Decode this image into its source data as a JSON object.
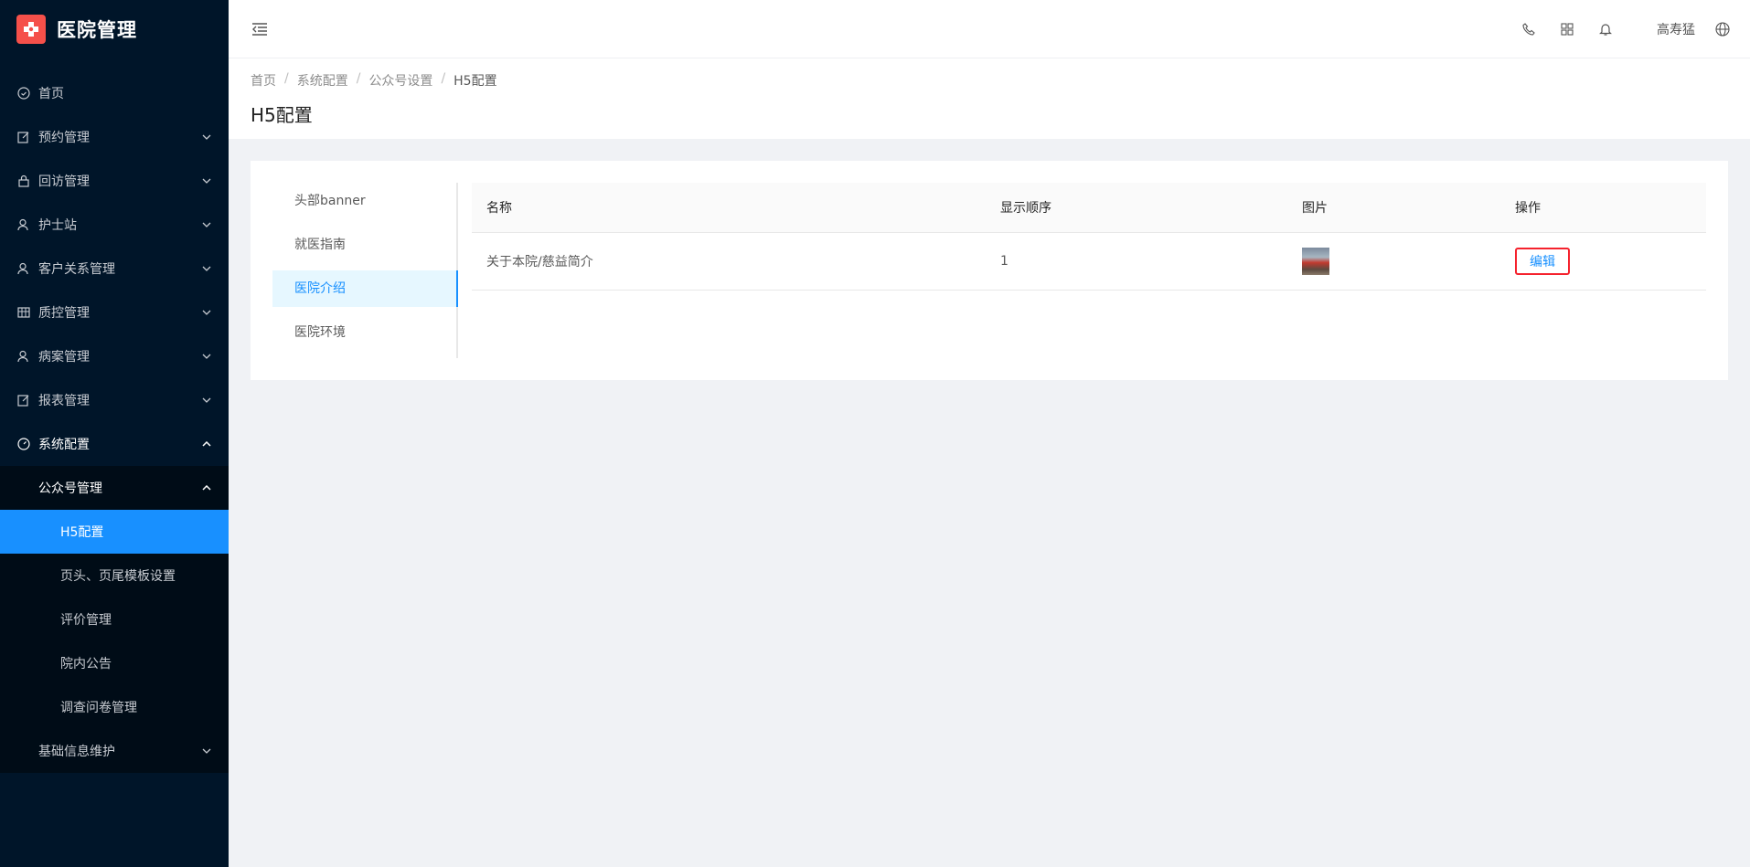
{
  "app": {
    "title": "医院管理"
  },
  "sidebar": {
    "items": [
      {
        "label": "首页"
      },
      {
        "label": "预约管理"
      },
      {
        "label": "回访管理"
      },
      {
        "label": "护士站"
      },
      {
        "label": "客户关系管理"
      },
      {
        "label": "质控管理"
      },
      {
        "label": "病案管理"
      },
      {
        "label": "报表管理"
      },
      {
        "label": "系统配置"
      }
    ],
    "system_sub": {
      "group_label": "公众号管理",
      "items": [
        {
          "label": "H5配置"
        },
        {
          "label": "页头、页尾模板设置"
        },
        {
          "label": "评价管理"
        },
        {
          "label": "院内公告"
        },
        {
          "label": "调查问卷管理"
        }
      ],
      "basic_info_label": "基础信息维护"
    }
  },
  "topbar": {
    "username": "高寿猛"
  },
  "breadcrumb": [
    "首页",
    "系统配置",
    "公众号设置",
    "H5配置"
  ],
  "page_title": "H5配置",
  "tabs": [
    "头部banner",
    "就医指南",
    "医院介绍",
    "医院环境"
  ],
  "table": {
    "headers": [
      "名称",
      "显示顺序",
      "图片",
      "操作"
    ],
    "rows": [
      {
        "name": "关于本院/慈益简介",
        "order": "1",
        "action": "编辑"
      }
    ]
  },
  "colors": {
    "sidebar_bg": "#001529",
    "accent": "#1890ff",
    "highlight_border": "#f5222d",
    "logo_bg": "#f5504a"
  }
}
